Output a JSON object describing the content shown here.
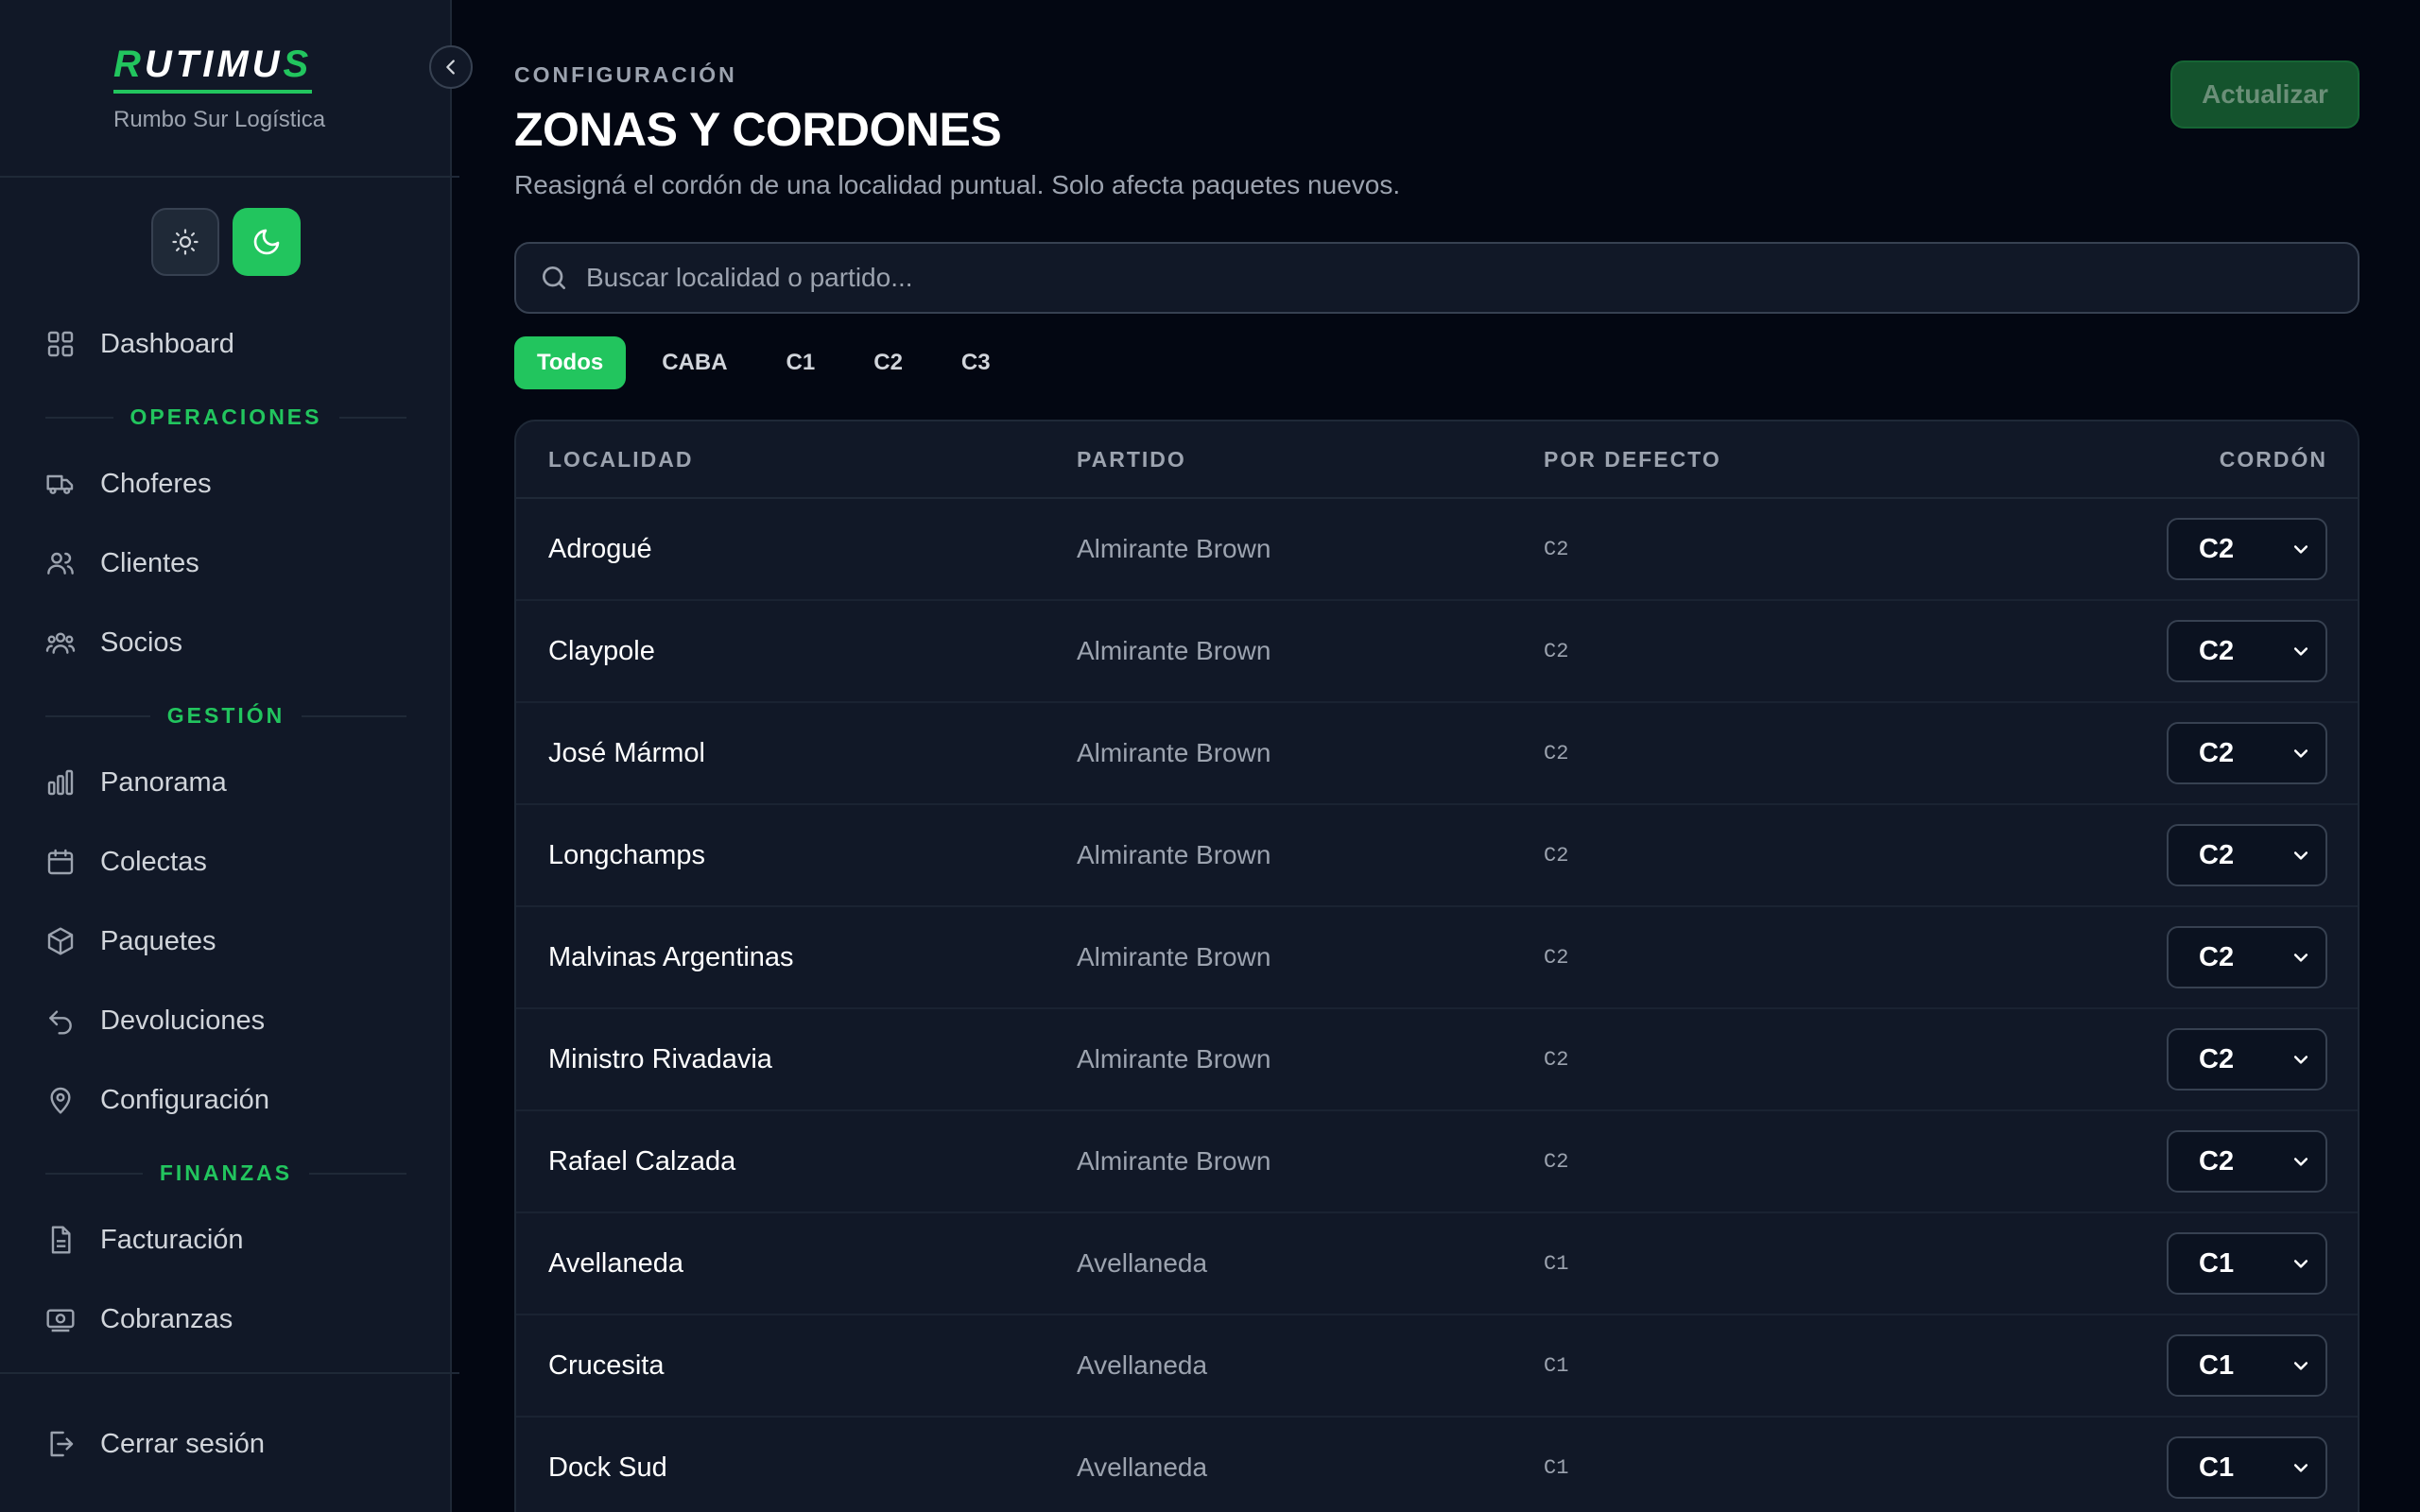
{
  "sidebar": {
    "brand": {
      "logo_first": "R",
      "logo_middle": "UTIMU",
      "logo_last": "S",
      "subtitle": "Rumbo Sur Logística"
    },
    "nav": {
      "dashboard": "Dashboard",
      "operaciones_label": "OPERACIONES",
      "choferes": "Choferes",
      "clientes": "Clientes",
      "socios": "Socios",
      "gestion_label": "GESTIÓN",
      "panorama": "Panorama",
      "colectas": "Colectas",
      "paquetes": "Paquetes",
      "devoluciones": "Devoluciones",
      "configuracion": "Configuración",
      "finanzas_label": "FINANZAS",
      "facturacion": "Facturación",
      "cobranzas": "Cobranzas",
      "logout": "Cerrar sesión"
    }
  },
  "header": {
    "eyebrow": "CONFIGURACIÓN",
    "title": "ZONAS Y CORDONES",
    "description": "Reasigná el cordón de una localidad puntual. Solo afecta paquetes nuevos.",
    "update_label": "Actualizar"
  },
  "search": {
    "placeholder": "Buscar localidad o partido..."
  },
  "filters": [
    "Todos",
    "CABA",
    "C1",
    "C2",
    "C3"
  ],
  "table": {
    "headers": [
      "LOCALIDAD",
      "PARTIDO",
      "POR DEFECTO",
      "CORDÓN"
    ],
    "rows": [
      {
        "localidad": "Adrogué",
        "partido": "Almirante Brown",
        "defecto": "C2",
        "cordon": "C2"
      },
      {
        "localidad": "Claypole",
        "partido": "Almirante Brown",
        "defecto": "C2",
        "cordon": "C2"
      },
      {
        "localidad": "José Mármol",
        "partido": "Almirante Brown",
        "defecto": "C2",
        "cordon": "C2"
      },
      {
        "localidad": "Longchamps",
        "partido": "Almirante Brown",
        "defecto": "C2",
        "cordon": "C2"
      },
      {
        "localidad": "Malvinas Argentinas",
        "partido": "Almirante Brown",
        "defecto": "C2",
        "cordon": "C2"
      },
      {
        "localidad": "Ministro Rivadavia",
        "partido": "Almirante Brown",
        "defecto": "C2",
        "cordon": "C2"
      },
      {
        "localidad": "Rafael Calzada",
        "partido": "Almirante Brown",
        "defecto": "C2",
        "cordon": "C2"
      },
      {
        "localidad": "Avellaneda",
        "partido": "Avellaneda",
        "defecto": "C1",
        "cordon": "C1"
      },
      {
        "localidad": "Crucesita",
        "partido": "Avellaneda",
        "defecto": "C1",
        "cordon": "C1"
      },
      {
        "localidad": "Dock Sud",
        "partido": "Avellaneda",
        "defecto": "C1",
        "cordon": "C1"
      }
    ]
  },
  "colors": {
    "accent": "#22c55e",
    "background": "#030712",
    "panel": "#111827"
  }
}
